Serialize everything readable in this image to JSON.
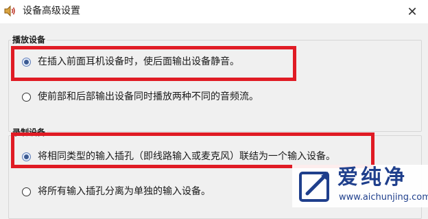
{
  "window": {
    "title": "设备高级设置",
    "close_glyph": "✕",
    "icon": "speaker-icon"
  },
  "playback_group": {
    "legend": "播放设备",
    "options": [
      {
        "label": "在插入前面耳机设备时，使后面输出设备静音。",
        "selected": true,
        "highlighted": true
      },
      {
        "label": "使前部和后部输出设备同时播放两种不同的音频流。",
        "selected": false,
        "highlighted": false
      }
    ]
  },
  "recording_group": {
    "legend": "录制设备",
    "options": [
      {
        "label": "将相同类型的输入插孔（即线路输入或麦克风）联结为一个输入设备。",
        "selected": true,
        "highlighted": true
      },
      {
        "label": "将所有输入插孔分离为单独的输入设备。",
        "selected": false,
        "highlighted": false
      }
    ]
  },
  "watermark": {
    "name": "爱纯净",
    "url": "www.aichunjing.com"
  },
  "colors": {
    "highlight": "#e01b24",
    "radio_dot": "#3c5a92",
    "watermark": "#1f3f8c"
  }
}
